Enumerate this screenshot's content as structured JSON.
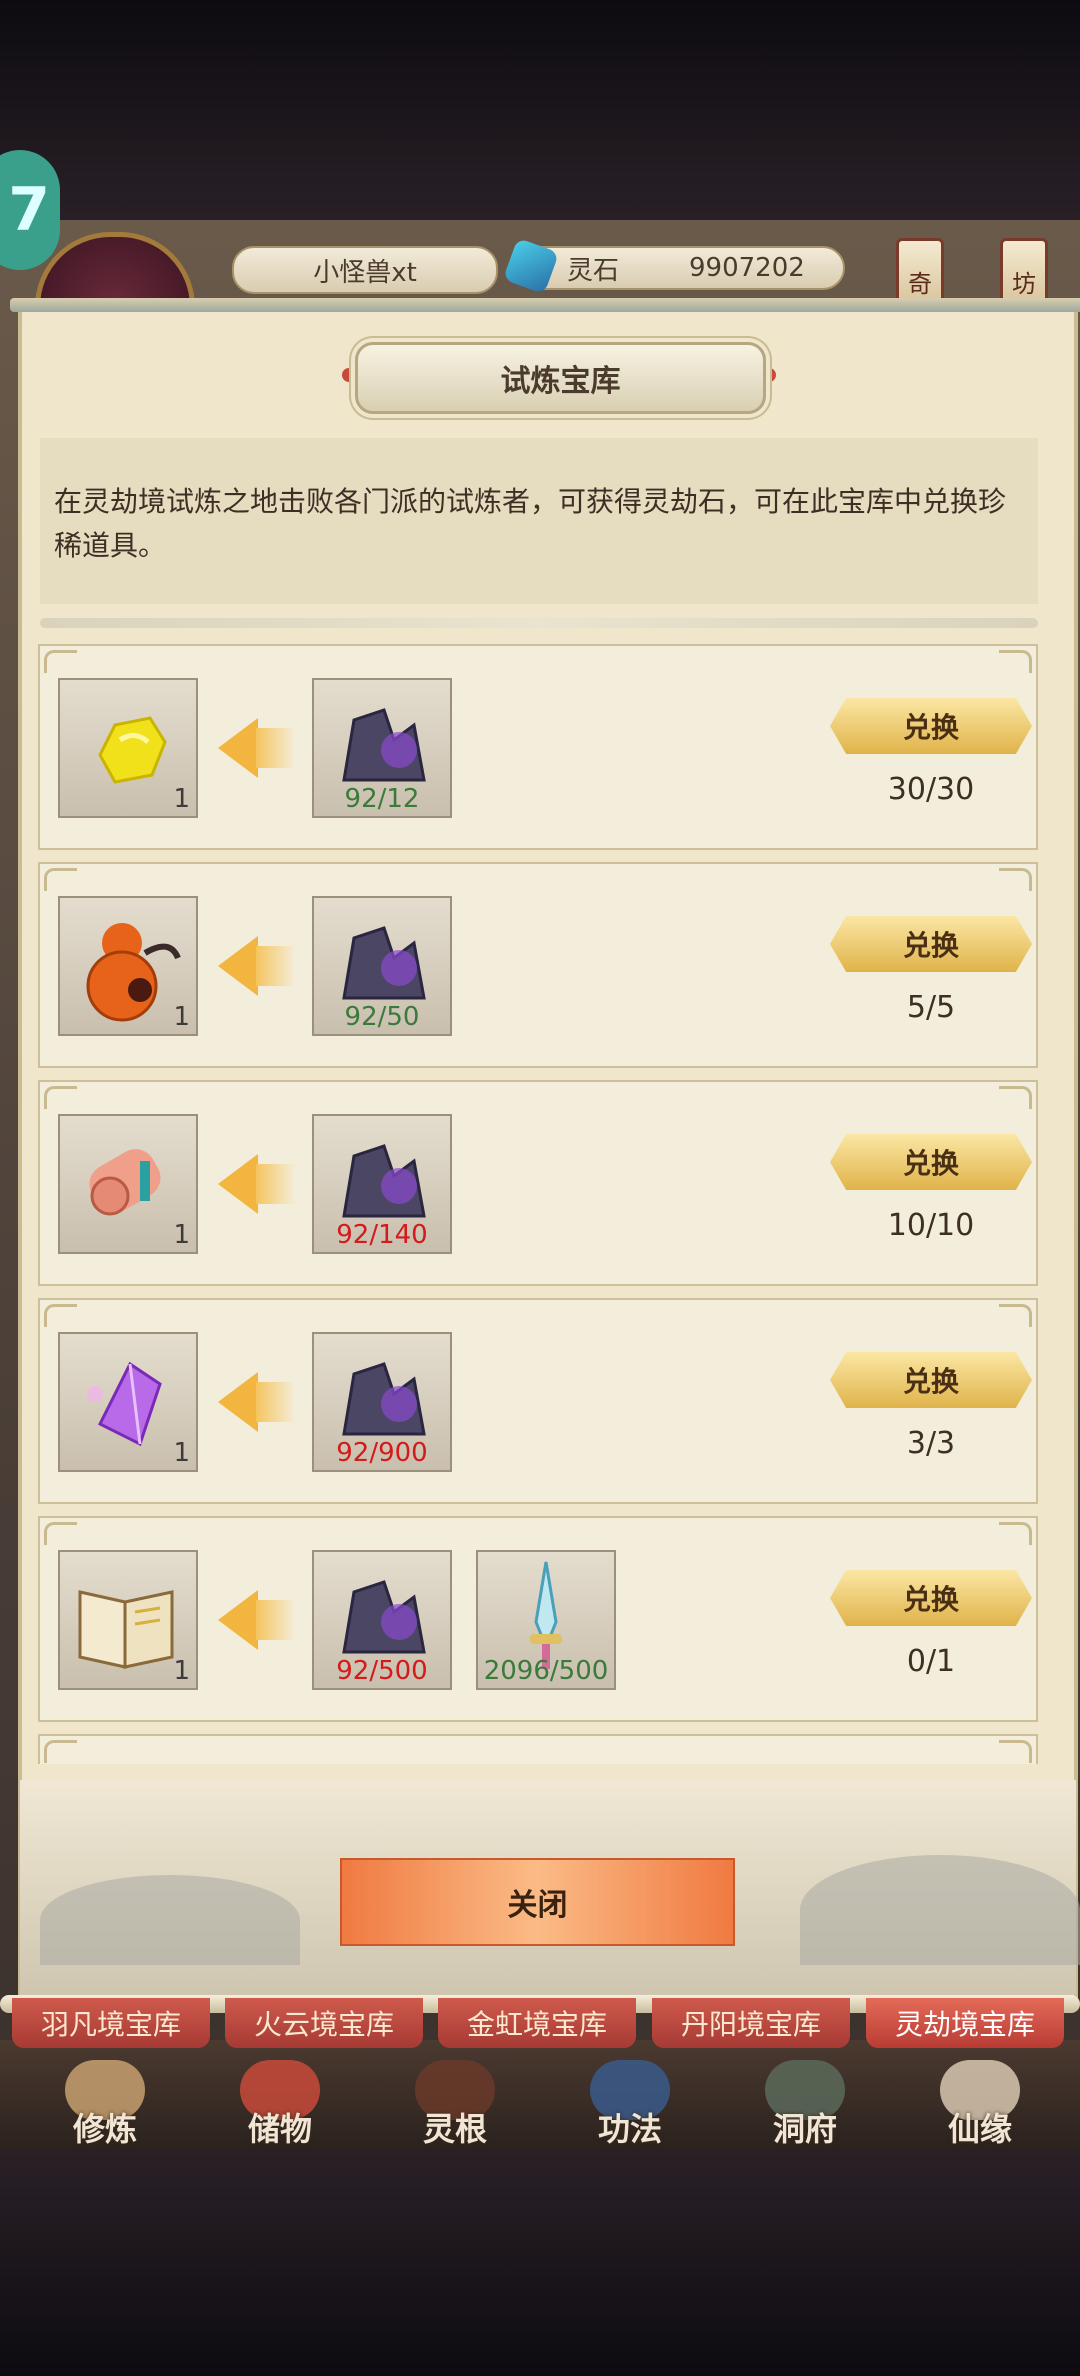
{
  "header": {
    "badge": "7",
    "player_name": "小怪兽xt",
    "currency_label": "灵石",
    "currency_value": "9907202",
    "right_lanterns": [
      "奇",
      "坊"
    ]
  },
  "panel": {
    "title": "试炼宝库",
    "description": "在灵劫境试炼之地击败各门派的试炼者，可获得灵劫石，可在此宝库中兑换珍稀道具。",
    "exchange_label": "兑换",
    "close_label": "关闭"
  },
  "items": [
    {
      "reward_icon": "yellow-crystal-icon",
      "reward_count": "1",
      "cost": [
        {
          "icon": "lingjie-stone-icon",
          "ratio": "92/12",
          "enough": true
        }
      ],
      "limit": "30/30"
    },
    {
      "reward_icon": "gourd-icon",
      "reward_count": "1",
      "cost": [
        {
          "icon": "lingjie-stone-icon",
          "ratio": "92/50",
          "enough": true
        }
      ],
      "limit": "5/5"
    },
    {
      "reward_icon": "scroll-icon",
      "reward_count": "1",
      "cost": [
        {
          "icon": "lingjie-stone-icon",
          "ratio": "92/140",
          "enough": false
        }
      ],
      "limit": "10/10"
    },
    {
      "reward_icon": "purple-crystal-icon",
      "reward_count": "1",
      "cost": [
        {
          "icon": "lingjie-stone-icon",
          "ratio": "92/900",
          "enough": false
        }
      ],
      "limit": "3/3"
    },
    {
      "reward_icon": "book-icon",
      "reward_count": "1",
      "cost": [
        {
          "icon": "lingjie-stone-icon",
          "ratio": "92/500",
          "enough": false
        },
        {
          "icon": "sword-icon",
          "ratio": "2096/500",
          "enough": true
        }
      ],
      "limit": "0/1"
    }
  ],
  "store_tabs": [
    "羽凡境宝库",
    "火云境宝库",
    "金虹境宝库",
    "丹阳境宝库",
    "灵劫境宝库"
  ],
  "active_tab": 4,
  "bottom_nav": [
    "修炼",
    "储物",
    "灵根",
    "功法",
    "洞府",
    "仙缘"
  ],
  "colors": {
    "enough": "#3a7a3a",
    "not_enough": "#d41a1a",
    "button_gold": "#e0b34a",
    "close_orange": "#f07a42"
  }
}
